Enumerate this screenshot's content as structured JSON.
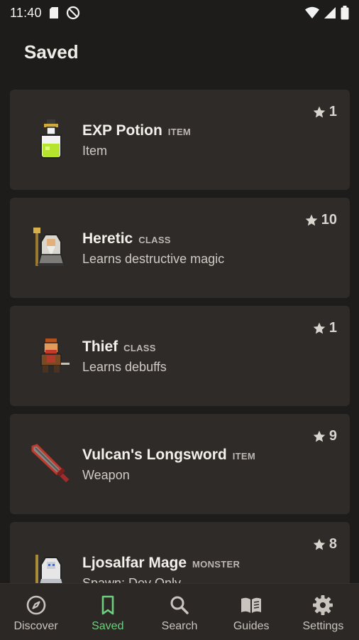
{
  "status_bar": {
    "time": "11:40"
  },
  "header": {
    "title": "Saved"
  },
  "cards": [
    {
      "name": "EXP Potion",
      "type": "ITEM",
      "subtitle": "Item",
      "favorites": "1",
      "icon": "potion-icon"
    },
    {
      "name": "Heretic",
      "type": "CLASS",
      "subtitle": "Learns destructive magic",
      "favorites": "10",
      "icon": "heretic-icon"
    },
    {
      "name": "Thief",
      "type": "CLASS",
      "subtitle": "Learns debuffs",
      "favorites": "1",
      "icon": "thief-icon"
    },
    {
      "name": "Vulcan's Longsword",
      "type": "ITEM",
      "subtitle": "Weapon",
      "favorites": "9",
      "icon": "sword-icon"
    },
    {
      "name": "Ljosalfar Mage",
      "type": "MONSTER",
      "subtitle": "Spawn: Dev Only",
      "favorites": "8",
      "icon": "mage-icon"
    }
  ],
  "nav": {
    "active": "Saved",
    "accent_color": "#6ecf7e",
    "items": [
      {
        "label": "Discover",
        "icon": "compass-icon"
      },
      {
        "label": "Saved",
        "icon": "bookmark-icon"
      },
      {
        "label": "Search",
        "icon": "search-icon"
      },
      {
        "label": "Guides",
        "icon": "book-icon"
      },
      {
        "label": "Settings",
        "icon": "gear-icon"
      }
    ]
  }
}
